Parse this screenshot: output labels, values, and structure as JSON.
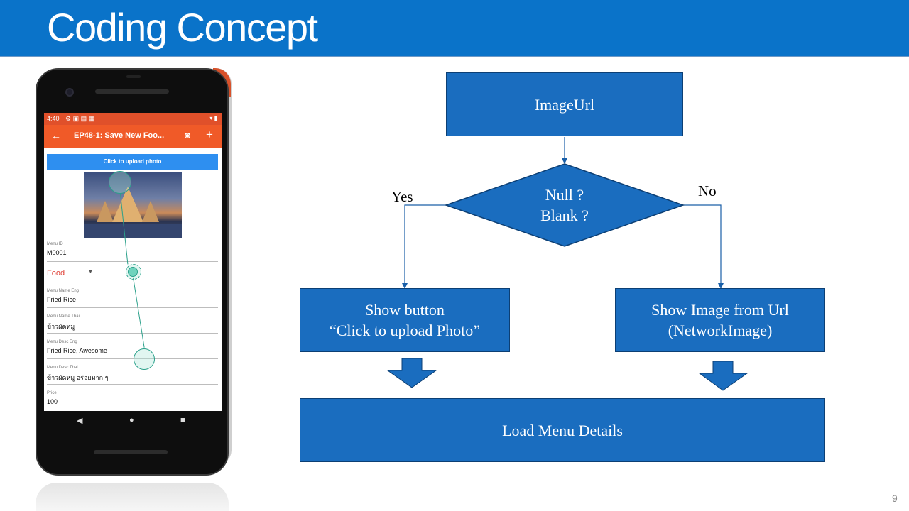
{
  "slide": {
    "title": "Coding Concept",
    "page_number": "9"
  },
  "phone": {
    "status_time": "4:40",
    "status_icons": "▾ ▮",
    "appbar_title": "EP48-1: Save New Foo...",
    "upload_button": "Click to upload photo",
    "fields": [
      {
        "label": "Menu ID",
        "value": "M0001"
      },
      {
        "label": "Menu Name Eng",
        "value": "Fried Rice"
      },
      {
        "label": "Menu Name Thai",
        "value": "ข้าวผัดหมู"
      },
      {
        "label": "Menu Desc Eng",
        "value": "Fried Rice, Awesome"
      },
      {
        "label": "Menu Desc Thai",
        "value": "ข้าวผัดหมู อร่อยมาก ๆ"
      },
      {
        "label": "Price",
        "value": "100"
      }
    ],
    "category_value": "Food"
  },
  "flowchart": {
    "start": "ImageUrl",
    "decision_line1": "Null ?",
    "decision_line2": "Blank ?",
    "yes_label": "Yes",
    "no_label": "No",
    "yes_box_line1": "Show button",
    "yes_box_line2": "“Click to upload Photo”",
    "no_box_line1": "Show Image from Url",
    "no_box_line2": "(NetworkImage)",
    "end": "Load Menu Details"
  },
  "colors": {
    "title_bar": "#0a73c9",
    "box_fill": "#1a6dbf",
    "box_border": "#0c3f74",
    "app_bar": "#f05a28"
  }
}
